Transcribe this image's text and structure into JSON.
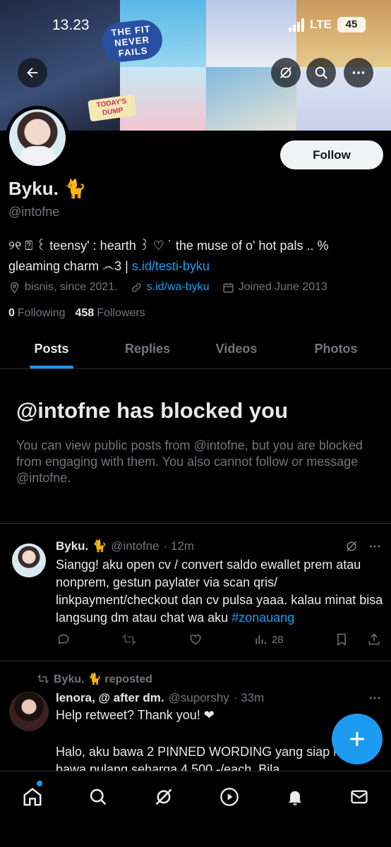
{
  "status_bar": {
    "time": "13.23",
    "network": "LTE",
    "battery": "45"
  },
  "banner": {
    "sticker_text": "THE FIT NEVER FAILS",
    "sticker_dump": "TODAY'S DUMP"
  },
  "profile": {
    "follow_label": "Follow",
    "name": "Byku. 🐈",
    "handle": "@intofne",
    "bio_text": "୨୧ ⍰ ꒰ teensy' : hearth ꒱ ♡ ˙ the muse of o' hot pals .. % gleaming charm ෴3 | ",
    "bio_link": "s.id/testi-byku",
    "location": "bisnis, since 2021.",
    "website": "s.id/wa-byku",
    "joined": "Joined June 2013",
    "following_count": "0",
    "following_label": "Following",
    "followers_count": "458",
    "followers_label": "Followers"
  },
  "tabs": [
    {
      "label": "Posts",
      "active": true
    },
    {
      "label": "Replies",
      "active": false
    },
    {
      "label": "Videos",
      "active": false
    },
    {
      "label": "Photos",
      "active": false
    }
  ],
  "blocked": {
    "title": "@intofne has blocked you",
    "text": "You can view public posts from @intofne, but you are blocked from engaging with them. You also cannot follow or message @intofne."
  },
  "post1": {
    "name": "Byku. 🐈",
    "handle": "@intofne",
    "time": "· 12m",
    "text": "Siangg! aku open cv / convert saldo ewallet prem atau nonprem, gestun paylater via scan qris/ linkpayment/checkout dan cv pulsa yaaa. kalau minat bisa langsung dm atau chat wa aku ",
    "hashtag": "#zonauang",
    "views": "28"
  },
  "post2": {
    "repost_label": "Byku. 🐈 reposted",
    "name": "lenora, @ after dm.",
    "handle": "@suporshy",
    "time": "· 33m",
    "line1": "Help retweet? Thank you! ❤",
    "line2": "Halo, aku bawa 2 PINNED WORDING yang siap kamu bawa pulang seharga 4.500,-/each. Bila"
  },
  "colors": {
    "accent": "#1d9bf0",
    "background": "#000000",
    "secondary_text": "#71767b"
  }
}
